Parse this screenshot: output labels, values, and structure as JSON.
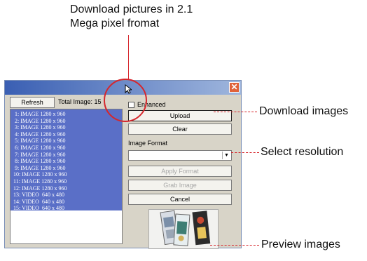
{
  "annotations": {
    "top_line1": "Download pictures in 2.1",
    "top_line2": "Mega pixel fromat",
    "download_images": "Download images",
    "select_resolution": "Select resolution",
    "preview_images": "Preview images"
  },
  "window": {
    "close_glyph": "✕",
    "refresh_label": "Refresh",
    "total_label": "Total Image: 15",
    "enhanced_label": "Enhanced",
    "upload_label": "Upload",
    "clear_label": "Clear",
    "format_label": "Image Format",
    "format_value": "",
    "apply_label": "Apply Format",
    "grab_label": "Grab Image",
    "cancel_label": "Cancel"
  },
  "image_list": [
    " 1: IMAGE 1280 x 960",
    " 2: IMAGE 1280 x 960",
    " 3: IMAGE 1280 x 960",
    " 4: IMAGE 1280 x 960",
    " 5: IMAGE 1280 x 960",
    " 6: IMAGE 1280 x 960",
    " 7: IMAGE 1280 x 960",
    " 8: IMAGE 1280 x 960",
    " 9: IMAGE 1280 x 960",
    "10: IMAGE 1280 x 960",
    "11: IMAGE 1280 x 960",
    "12: IMAGE 1280 x 960",
    "13: VIDEO  640 x 480",
    "14: VIDEO  640 x 480",
    "15: VIDEO  640 x 480"
  ],
  "colors": {
    "accent_red": "#d6262c",
    "list_selection": "#5a6fc7",
    "titlebar": "#3a5fb3"
  }
}
